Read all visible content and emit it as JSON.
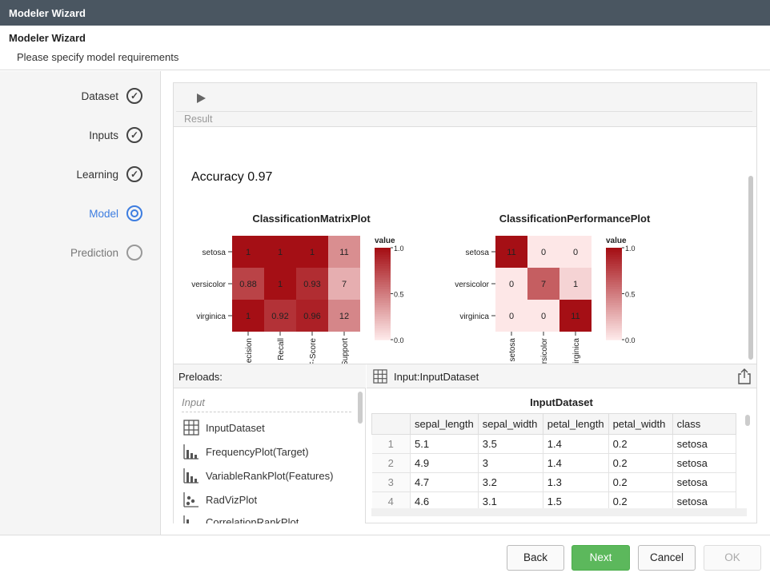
{
  "window": {
    "title": "Modeler Wizard"
  },
  "header": {
    "title": "Modeler Wizard",
    "subtitle": "Please specify model requirements"
  },
  "steps": [
    {
      "label": "Dataset",
      "state": "done"
    },
    {
      "label": "Inputs",
      "state": "done"
    },
    {
      "label": "Learning",
      "state": "done"
    },
    {
      "label": "Model",
      "state": "active"
    },
    {
      "label": "Prediction",
      "state": "future"
    }
  ],
  "toolbar": {
    "result_label": "Result",
    "run_icon": "play-icon"
  },
  "result": {
    "accuracy_text": "Accuracy 0.97"
  },
  "chart_data": [
    {
      "type": "heatmap",
      "title": "ClassificationMatrixPlot",
      "rows": [
        "setosa",
        "versicolor",
        "virginica"
      ],
      "columns": [
        "Precision",
        "Recall",
        "F-Score",
        "Support"
      ],
      "column_labels_visible": [
        "ecision",
        "Recall",
        "F-Score",
        "Support"
      ],
      "values": [
        [
          1,
          1,
          1,
          11
        ],
        [
          0.88,
          1,
          0.93,
          7
        ],
        [
          1,
          0.92,
          0.96,
          12
        ]
      ],
      "legend": {
        "title": "value",
        "ticks": [
          "1.0",
          "0.5",
          "0.0"
        ]
      }
    },
    {
      "type": "heatmap",
      "title": "ClassificationPerformancePlot",
      "rows": [
        "setosa",
        "versicolor",
        "virginica"
      ],
      "columns": [
        "setosa",
        "versicolor",
        "virginica"
      ],
      "column_labels_visible": [
        "setosa",
        "rsicolor",
        "irginica"
      ],
      "values": [
        [
          11,
          0,
          0
        ],
        [
          0,
          7,
          1
        ],
        [
          0,
          0,
          11
        ]
      ],
      "legend": {
        "title": "value",
        "ticks": [
          "1.0",
          "0.5",
          "0.0"
        ]
      }
    }
  ],
  "preloads": {
    "header": "Preloads:",
    "section_label": "Input",
    "items": [
      {
        "label": "InputDataset",
        "icon": "table-icon"
      },
      {
        "label": "FrequencyPlot(Target)",
        "icon": "bar-chart-icon"
      },
      {
        "label": "VariableRankPlot(Features)",
        "icon": "bar-chart-icon"
      },
      {
        "label": "RadVizPlot",
        "icon": "scatter-icon"
      },
      {
        "label": "CorrelationRankPlot",
        "icon": "bar-chart-icon"
      }
    ]
  },
  "dataset": {
    "header": "Input:InputDataset",
    "title": "InputDataset",
    "columns": [
      "sepal_length",
      "sepal_width",
      "petal_length",
      "petal_width",
      "class"
    ],
    "rows": [
      [
        "1",
        "5.1",
        "3.5",
        "1.4",
        "0.2",
        "setosa"
      ],
      [
        "2",
        "4.9",
        "3",
        "1.4",
        "0.2",
        "setosa"
      ],
      [
        "3",
        "4.7",
        "3.2",
        "1.3",
        "0.2",
        "setosa"
      ],
      [
        "4",
        "4.6",
        "3.1",
        "1.5",
        "0.2",
        "setosa"
      ]
    ]
  },
  "footer": {
    "back": "Back",
    "next": "Next",
    "cancel": "Cancel",
    "ok": "OK"
  },
  "colors": {
    "accent": "#3d7de0",
    "next": "#5cb85c",
    "heat_high": "#a50f15",
    "heat_low": "#fde7e7"
  }
}
